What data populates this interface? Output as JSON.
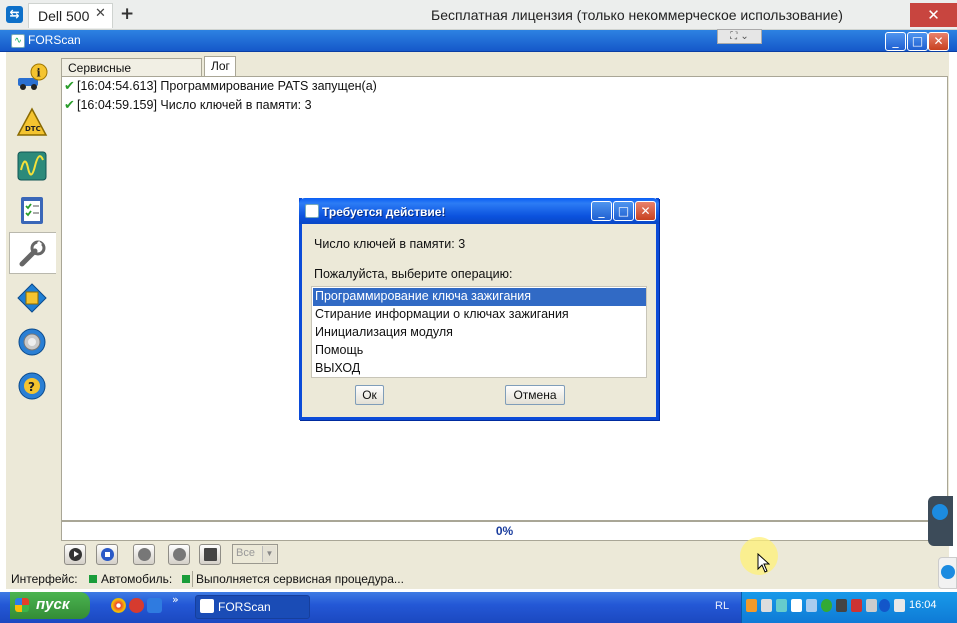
{
  "teamviewer": {
    "tab_label": "Dell 500",
    "tab_close": "✕",
    "new_tab": "+",
    "license_text": "Бесплатная лицензия (только некоммерческое использование)",
    "close": "✕",
    "float_toolbar": "⛶ ⌄"
  },
  "window": {
    "title": "FORScan",
    "minimize": "_",
    "maximize": "□",
    "close": "✕"
  },
  "tabs": [
    {
      "label": "Сервисные процедуры"
    },
    {
      "label": "Лог"
    }
  ],
  "log": [
    {
      "text": "[16:04:54.613] Программирование PATS запущен(а)"
    },
    {
      "text": "[16:04:59.159] Число ключей в памяти: 3"
    }
  ],
  "progress": {
    "text": "0%",
    "value_percent": 0
  },
  "toolbar": {
    "filter_value": "Все"
  },
  "status": {
    "interface_label": "Интерфейс:",
    "vehicle_label": "Автомобиль:",
    "procedure_text": "Выполняется сервисная процедура..."
  },
  "dialog": {
    "title": "Требуется действие!",
    "keys_text": "Число ключей в памяти: 3",
    "prompt": "Пожалуйста, выберите операцию:",
    "options": [
      "Программирование ключа зажигания",
      "Стирание информации о ключах зажигания",
      "Инициализация модуля",
      "Помощь",
      "ВЫХОД"
    ],
    "selected_index": 0,
    "ok": "Ок",
    "cancel": "Отмена",
    "minimize": "_",
    "maximize": "□",
    "close": "✕"
  },
  "taskbar": {
    "start": "пуск",
    "task": "FORScan",
    "lang": "RL",
    "clock": "16:04",
    "more": "»"
  },
  "colors": {
    "xp_blue": "#0b52de",
    "selection": "#316ac5",
    "ok_green": "#2a9d2a",
    "progress_text": "#1a3d9e"
  }
}
